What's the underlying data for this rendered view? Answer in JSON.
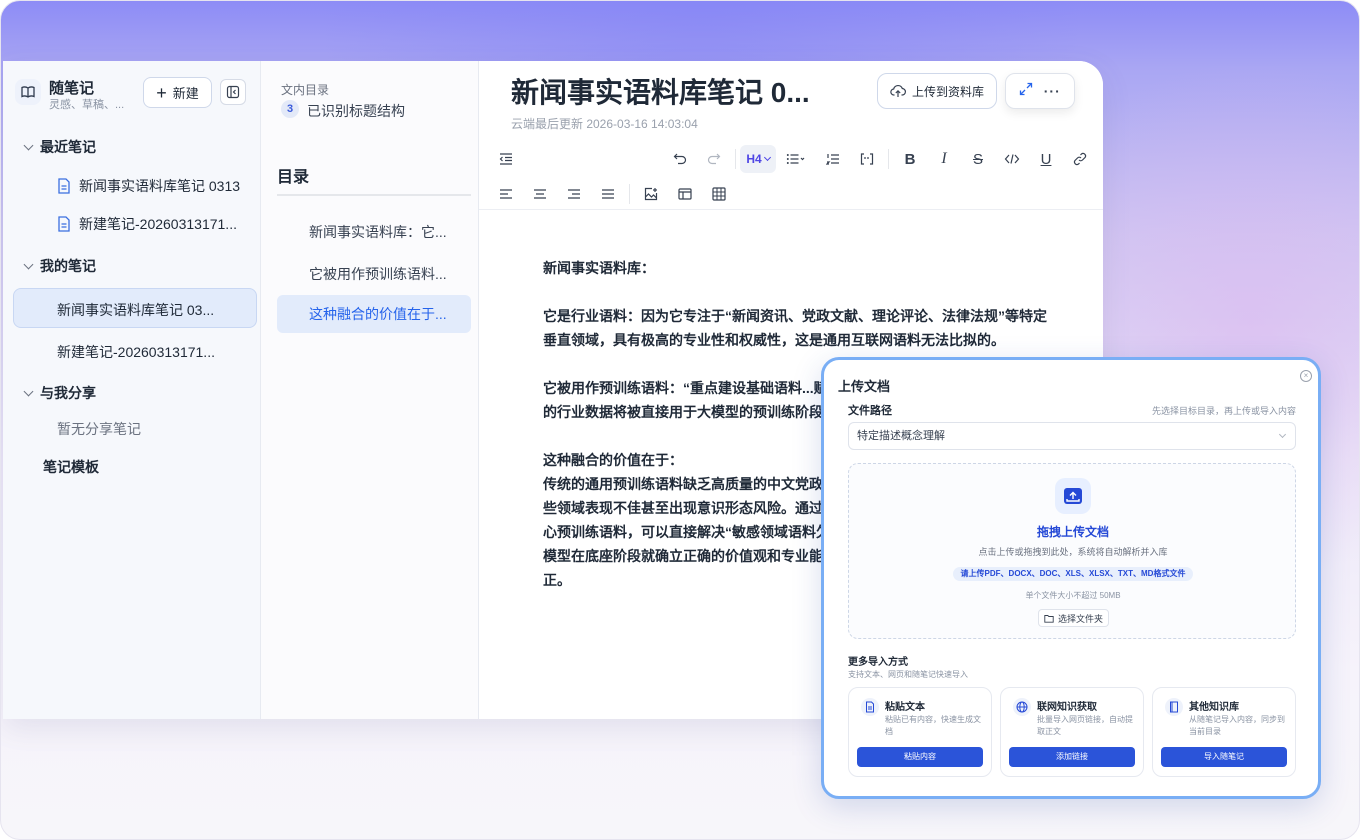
{
  "sidebar": {
    "title": "随笔记",
    "subtitle": "灵感、草稿、...",
    "new_button": "新建",
    "groups": [
      {
        "label": "最近笔记"
      },
      {
        "label": "我的笔记"
      },
      {
        "label": "与我分享"
      }
    ],
    "recent": [
      "新闻事实语料库笔记 0313",
      "新建笔记-20260313171..."
    ],
    "mine": [
      "新闻事实语料库笔记 03...",
      "新建笔记-20260313171..."
    ],
    "shared_empty": "暂无分享笔记",
    "templates": "笔记模板"
  },
  "toc": {
    "caption": "文内目录",
    "count": "3",
    "count_label": "已识别标题结构",
    "heading": "目录",
    "items": [
      "新闻事实语料库：它...",
      "它被用作预训练语料...",
      "这种融合的价值在于..."
    ],
    "active_index": 2
  },
  "editor": {
    "title": "新闻事实语料库笔记 0...",
    "updated": "云端最后更新 2026-03-16 14:03:04",
    "upload_button": "上传到资料库",
    "heading_level": "H4",
    "paragraphs": [
      [
        "新闻事实语料库："
      ],
      [
        "它是行业语料：因为它专注于“新闻资讯、党政文献、理论评论、法律法规”等特定",
        "垂直领域，具有极高的专业性和权威性，这是通用互联网语料无法比拟的。"
      ],
      [
        "它被用作预训练语料：“重点建设基础语料...赋",
        "的行业数据将被直接用于大模型的预训练阶段"
      ],
      [
        "这种融合的价值在于：",
        "传统的通用预训练语料缺乏高质量的中文党政",
        "些领域表现不佳甚至出现意识形态风险。通过",
        "心预训练语料，可以直接解决“敏感领域语料欠",
        "模型在底座阶段就确立正确的价值观和专业能",
        "正。"
      ]
    ]
  },
  "modal": {
    "title": "上传文档",
    "path_label": "文件路径",
    "path_hint": "先选择目标目录，再上传或导入内容",
    "path_value": "特定描述概念理解",
    "drop_title": "拖拽上传文档",
    "drop_subtitle": "点击上传或拖拽到此处，系统将自动解析并入库",
    "formats": "请上传PDF、DOCX、DOC、XLS、XLSX、TXT、MD格式文件",
    "size_limit": "单个文件大小不超过 50MB",
    "folder_button": "选择文件夹",
    "more_title": "更多导入方式",
    "more_subtitle": "支持文本、网页和随笔记快速导入",
    "cards": [
      {
        "title": "粘贴文本",
        "desc": "粘贴已有内容，快速生成文档",
        "button": "粘贴内容",
        "icon": "document-icon"
      },
      {
        "title": "联网知识获取",
        "desc": "批量导入网页链接，自动提取正文",
        "button": "添加链接",
        "icon": "globe-icon"
      },
      {
        "title": "其他知识库",
        "desc": "从随笔记导入内容，同步到当前目录",
        "button": "导入随笔记",
        "icon": "book-icon"
      }
    ]
  }
}
